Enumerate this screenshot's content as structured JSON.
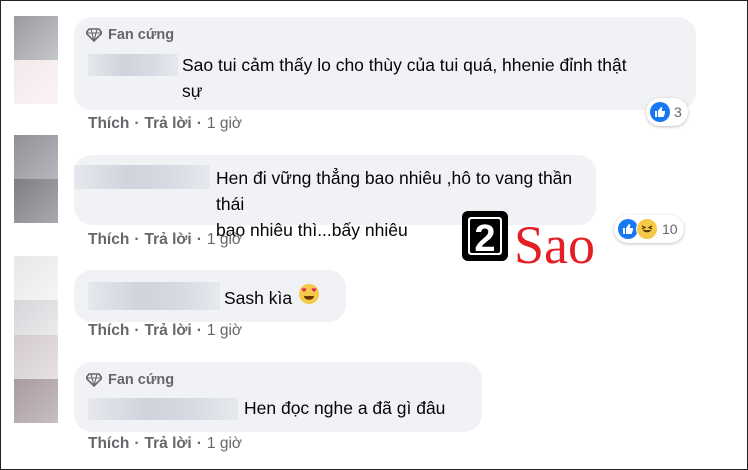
{
  "comments": [
    {
      "badge": "Fan cứng",
      "text_line1": "Sao tui cảm thấy lo cho thùy của tui quá, hhenie đỉnh thật",
      "text_line2": "sự",
      "actions": {
        "like": "Thích",
        "reply": "Trả lời",
        "time": "1 giờ"
      },
      "reaction_count": "3"
    },
    {
      "text_line1": "Hen đi vững thẳng bao nhiêu ,hô to vang thần thái",
      "text_line2": "bao nhiêu thì...bấy nhiêu",
      "actions": {
        "like": "Thích",
        "reply": "Trả lời",
        "time": "1 giờ"
      },
      "reaction_count": "10"
    },
    {
      "text": "Sash kìa",
      "emoji": "😍",
      "actions": {
        "like": "Thích",
        "reply": "Trả lời",
        "time": "1 giờ"
      }
    },
    {
      "badge": "Fan cứng",
      "text": "Hen đọc nghe a đã gì đâu",
      "actions": {
        "like": "Thích",
        "reply": "Trả lời",
        "time": "1 giờ"
      }
    }
  ],
  "watermark": {
    "number": "2",
    "word": "Sao"
  },
  "separator": "·",
  "colors": {
    "accent": "#1877f2",
    "bubble": "#f0f2f5",
    "meta": "#65676b",
    "logo_red": "#e31e24"
  }
}
